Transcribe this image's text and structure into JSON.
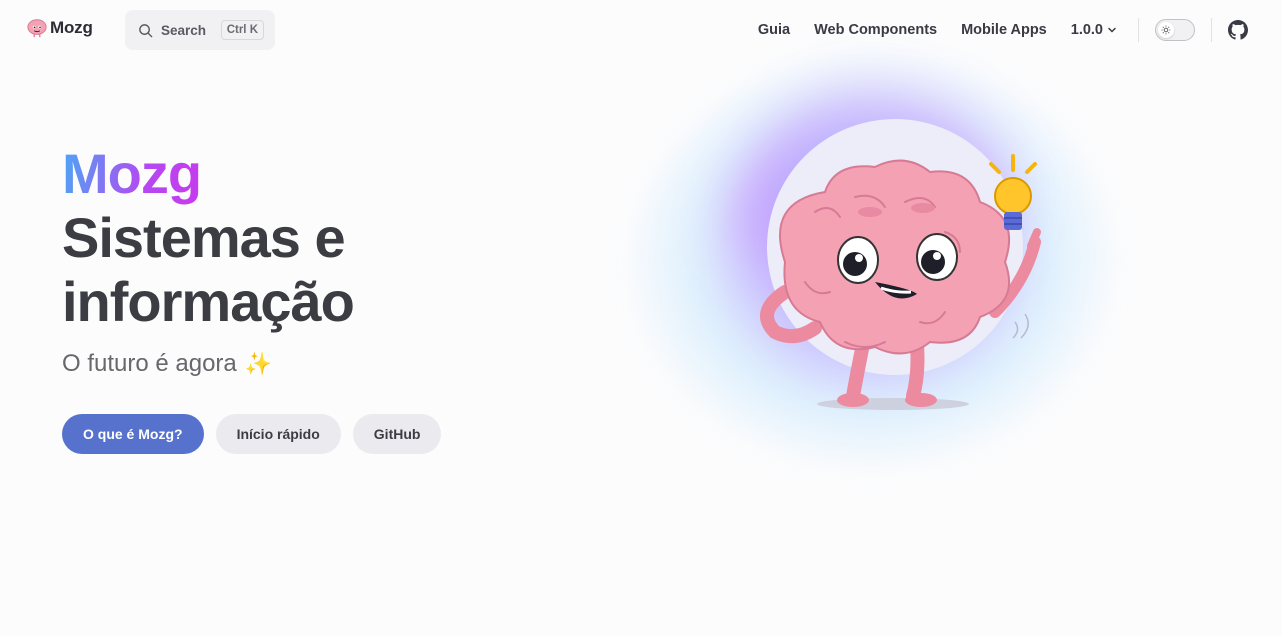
{
  "nav": {
    "brand": "Mozg",
    "search": {
      "placeholder": "Search",
      "shortcut": "Ctrl K"
    },
    "links": [
      "Guia",
      "Web Components",
      "Mobile Apps"
    ],
    "version": "1.0.0"
  },
  "hero": {
    "name": "Mozg",
    "text": "Sistemas e informação",
    "tagline": "O futuro é agora",
    "actions": [
      {
        "label": "O que é Mozg?",
        "theme": "brand"
      },
      {
        "label": "Início rápido",
        "theme": "alt"
      },
      {
        "label": "GitHub",
        "theme": "alt"
      }
    ]
  },
  "icons": {
    "logo": "brain-logo-icon",
    "search": "search-icon",
    "version_dropdown": "chevron-down-icon",
    "theme": "sun-icon",
    "github": "github-icon",
    "sparkles": "sparkles-icon",
    "mascot": "brain-mascot-with-lightbulb"
  },
  "colors": {
    "brand": "#5672cd",
    "gradient_start": "#4aa8f4",
    "gradient_end": "#c83aee",
    "mascot_pink": "#f4a1b4"
  }
}
